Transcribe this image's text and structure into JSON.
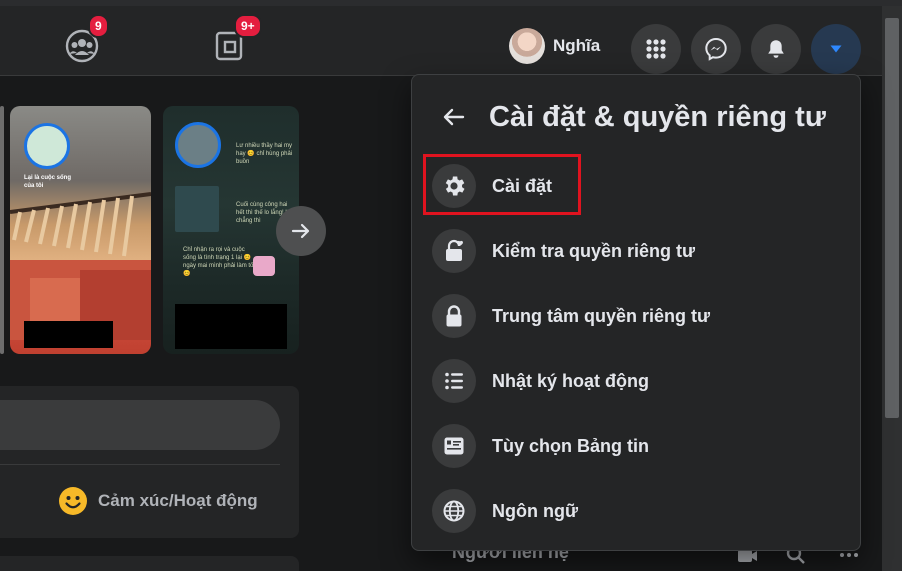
{
  "nav": {
    "groups_badge": "9",
    "pages_badge": "9+",
    "profile_name": "Nghĩa"
  },
  "stories": {
    "story2_text_top": "Lư nhiều thầy hai my hay 😊 chỉ hùng phải buồn",
    "story2_text_mid": "Cuối cùng công hai hết thì thế lo lắng! lời chẳng thì",
    "story2_text_bot": "Chỉ nhận ra rọi và cuộc sống là tình trạng 1 lại 😊 ngày mai mình phải làm tốt 😊",
    "story1_caption": "Lại là cuộc sống của tôi"
  },
  "composer": {
    "feeling_label": "Cảm xúc/Hoạt động"
  },
  "contacts_label": "Người liên hệ",
  "menu": {
    "title": "Cài đặt & quyền riêng tư",
    "items": [
      {
        "label": "Cài đặt",
        "icon": "gear-icon"
      },
      {
        "label": "Kiểm tra quyền riêng tư",
        "icon": "lock-heart-icon"
      },
      {
        "label": "Trung tâm quyền riêng tư",
        "icon": "lock-icon"
      },
      {
        "label": "Nhật ký hoạt động",
        "icon": "list-icon"
      },
      {
        "label": "Tùy chọn Bảng tin",
        "icon": "feed-icon"
      },
      {
        "label": "Ngôn ngữ",
        "icon": "globe-icon"
      }
    ]
  },
  "colors": {
    "accent": "#2d88ff",
    "badge": "#e41e3f",
    "highlight": "#e0131f",
    "surface": "#242526"
  }
}
